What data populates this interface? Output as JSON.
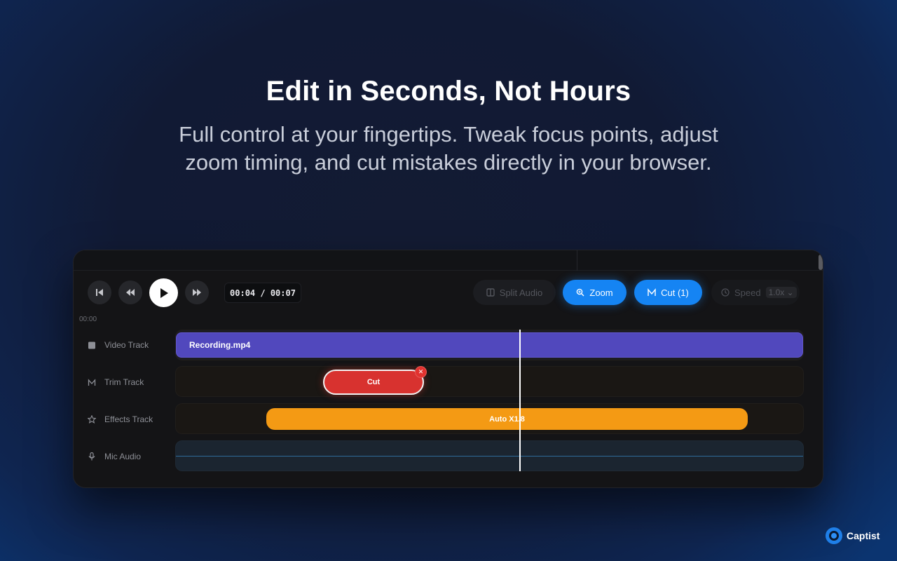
{
  "hero": {
    "title": "Edit in Seconds, Not Hours",
    "subtitle_line1": "Full control at your fingertips. Tweak focus points, adjust",
    "subtitle_line2": "zoom timing, and cut mistakes directly in your browser."
  },
  "player": {
    "timecode": "00:04 / 00:07",
    "ruler_start": "00:00"
  },
  "toolbar": {
    "split_audio_label": "Split Audio",
    "zoom_label": "Zoom",
    "cut_label": "Cut (1)",
    "speed_label": "Speed",
    "speed_value": "1.0x"
  },
  "tracks": [
    {
      "label": "Video Track",
      "icon": "square-icon"
    },
    {
      "label": "Trim Track",
      "icon": "cut-icon"
    },
    {
      "label": "Effects Track",
      "icon": "star-icon"
    },
    {
      "label": "Mic Audio",
      "icon": "mic-icon"
    }
  ],
  "clips": {
    "video": "Recording.mp4",
    "cut": "Cut",
    "effect": "Auto X1.8"
  },
  "brand": {
    "name": "Captist"
  },
  "colors": {
    "accent": "#1584f3",
    "video_clip": "#5148bd",
    "cut_clip": "#d8322f",
    "effect_clip": "#f49a14"
  }
}
